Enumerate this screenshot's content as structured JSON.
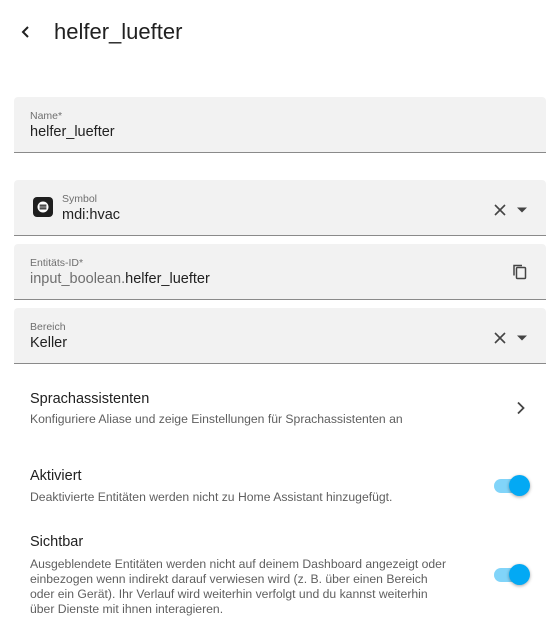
{
  "header": {
    "title": "helfer_luefter"
  },
  "name_field": {
    "label": "Name*",
    "value": "helfer_luefter"
  },
  "symbol_field": {
    "label": "Symbol",
    "value": "mdi:hvac",
    "icon": "hvac-icon"
  },
  "entity_field": {
    "label": "Entitäts-ID*",
    "prefix": "input_boolean.",
    "value": "helfer_luefter"
  },
  "area_field": {
    "label": "Bereich",
    "value": "Keller"
  },
  "voice_assistants": {
    "title": "Sprachassistenten",
    "description": "Konfiguriere Aliase und zeige Einstellungen für Sprachassistenten an"
  },
  "enabled": {
    "title": "Aktiviert",
    "description": "Deaktivierte Entitäten werden nicht zu Home Assistant hinzugefügt.",
    "on": true
  },
  "visible": {
    "title": "Sichtbar",
    "description_lines": [
      "Ausgeblendete Entitäten werden nicht auf deinem Dashboard angezeigt oder",
      "einbezogen wenn indirekt darauf verwiesen wird (z. B. über einen Bereich",
      "oder ein Gerät). Ihr Verlauf wird weiterhin verfolgt und du kannst weiterhin",
      "über Dienste mit ihnen interagieren."
    ],
    "on": true
  },
  "colors": {
    "accent": "#03a9f4",
    "field_background": "#f2f2f2"
  }
}
